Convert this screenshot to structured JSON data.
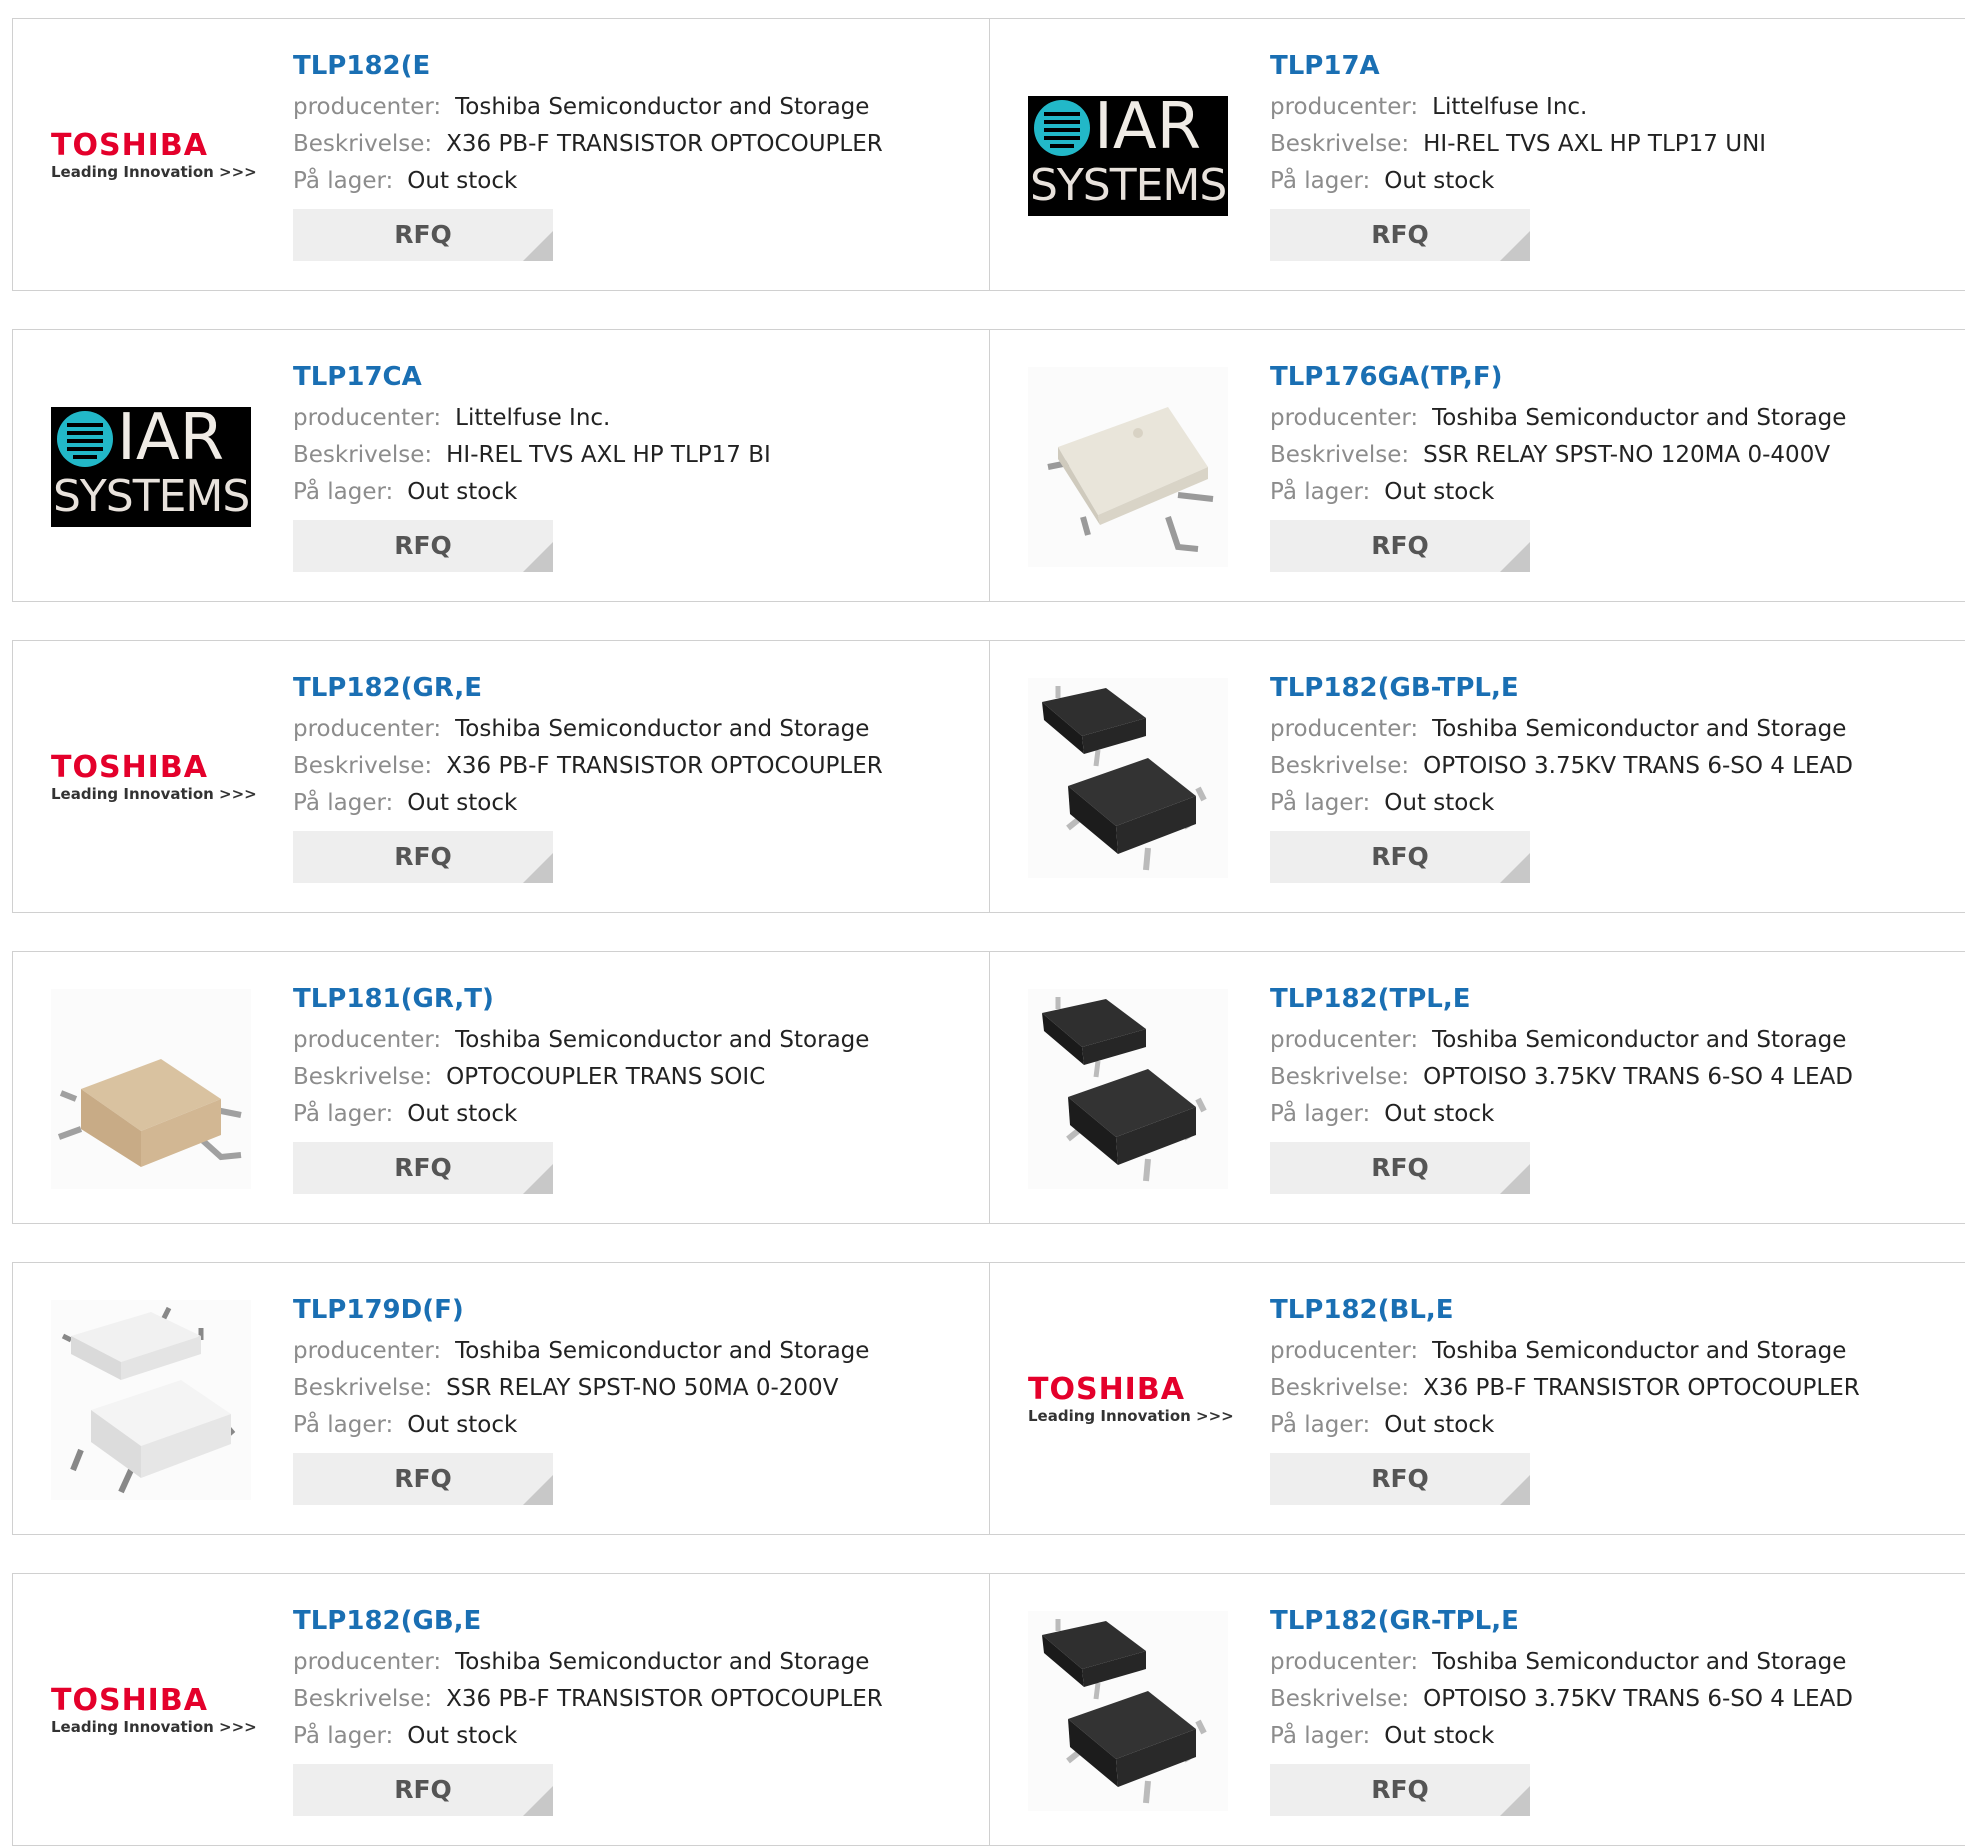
{
  "labels": {
    "manufacturer": "producenter:",
    "description": "Beskrivelse:",
    "stock": "På lager:",
    "rfq": "RFQ"
  },
  "colors": {
    "part_link": "#1a6fb3",
    "label_gray": "#8c8c8c",
    "rfq_bg": "#eeeeee",
    "toshiba_red": "#e4002b",
    "iar_cyan": "#22b8c8"
  },
  "logo_text": {
    "toshiba": "TOSHIBA",
    "toshiba_tagline": "Leading Innovation >>>",
    "iar": "IAR",
    "iar_systems": "SYSTEMS"
  },
  "products": [
    {
      "part": "TLP182(E",
      "manufacturer": "Toshiba Semiconductor and Storage",
      "description": "X36 PB-F TRANSISTOR OPTOCOUPLER",
      "stock": "Out stock",
      "image": "toshiba-logo"
    },
    {
      "part": "TLP17A",
      "manufacturer": "Littelfuse Inc.",
      "description": "HI-REL TVS AXL HP TLP17 UNI",
      "stock": "Out stock",
      "image": "iar-systems-logo"
    },
    {
      "part": "TLP17CA",
      "manufacturer": "Littelfuse Inc.",
      "description": "HI-REL TVS AXL HP TLP17 BI",
      "stock": "Out stock",
      "image": "iar-systems-logo"
    },
    {
      "part": "TLP176GA(TP,F)",
      "manufacturer": "Toshiba Semiconductor and Storage",
      "description": "SSR RELAY SPST-NO 120MA 0-400V",
      "stock": "Out stock",
      "image": "chip-photo-cream"
    },
    {
      "part": "TLP182(GR,E",
      "manufacturer": "Toshiba Semiconductor and Storage",
      "description": "X36 PB-F TRANSISTOR OPTOCOUPLER",
      "stock": "Out stock",
      "image": "toshiba-logo"
    },
    {
      "part": "TLP182(GB-TPL,E",
      "manufacturer": "Toshiba Semiconductor and Storage",
      "description": "OPTOISO 3.75KV TRANS 6-SO 4 LEAD",
      "stock": "Out stock",
      "image": "chip-photo-black-pair"
    },
    {
      "part": "TLP181(GR,T)",
      "manufacturer": "Toshiba Semiconductor and Storage",
      "description": "OPTOCOUPLER TRANS SOIC",
      "stock": "Out stock",
      "image": "chip-photo-tan"
    },
    {
      "part": "TLP182(TPL,E",
      "manufacturer": "Toshiba Semiconductor and Storage",
      "description": "OPTOISO 3.75KV TRANS 6-SO 4 LEAD",
      "stock": "Out stock",
      "image": "chip-photo-black-pair"
    },
    {
      "part": "TLP179D(F)",
      "manufacturer": "Toshiba Semiconductor and Storage",
      "description": "SSR RELAY SPST-NO 50MA 0-200V",
      "stock": "Out stock",
      "image": "chip-photo-white-pair"
    },
    {
      "part": "TLP182(BL,E",
      "manufacturer": "Toshiba Semiconductor and Storage",
      "description": "X36 PB-F TRANSISTOR OPTOCOUPLER",
      "stock": "Out stock",
      "image": "toshiba-logo"
    },
    {
      "part": "TLP182(GB,E",
      "manufacturer": "Toshiba Semiconductor and Storage",
      "description": "X36 PB-F TRANSISTOR OPTOCOUPLER",
      "stock": "Out stock",
      "image": "toshiba-logo"
    },
    {
      "part": "TLP182(GR-TPL,E",
      "manufacturer": "Toshiba Semiconductor and Storage",
      "description": "OPTOISO 3.75KV TRANS 6-SO 4 LEAD",
      "stock": "Out stock",
      "image": "chip-photo-black-pair"
    }
  ]
}
